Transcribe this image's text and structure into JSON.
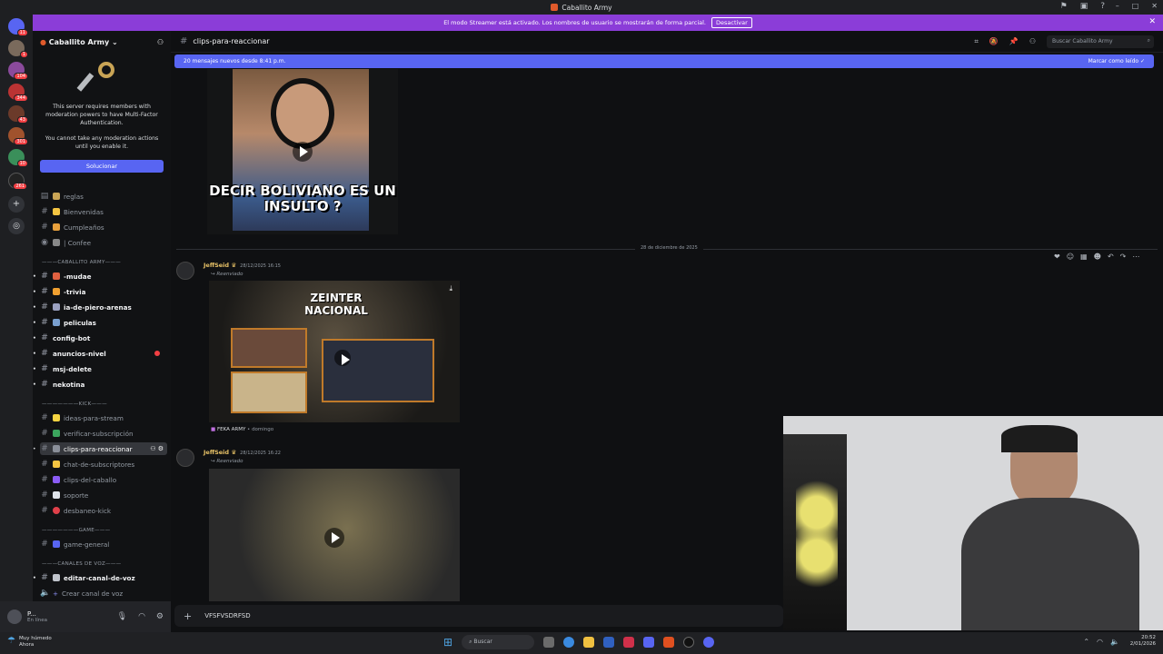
{
  "window": {
    "title": "Caballito Army"
  },
  "streamer_banner": {
    "text": "El modo Streamer está activado. Los nombres de usuario se mostrarán de forma parcial.",
    "button": "Desactivar"
  },
  "servers": [
    {
      "badge": "11"
    },
    {
      "badge": "1"
    },
    {
      "badge": "104"
    },
    {
      "badge": "344"
    },
    {
      "badge": "43"
    },
    {
      "badge": "301"
    },
    {
      "badge": "10"
    },
    {
      "badge": "261"
    }
  ],
  "sidebar": {
    "guild_name": "Caballito Army",
    "mfa_notice": {
      "line1": "This server requires members with moderation powers to have Multi-Factor Authentication.",
      "line2": "You cannot take any moderation actions until you enable it.",
      "fix_button": "Solucionar"
    },
    "channels_top": [
      {
        "name": "reglas"
      },
      {
        "name": "Bienvenidas"
      },
      {
        "name": "Cumpleaños"
      },
      {
        "name": "| Confee"
      }
    ],
    "cat_caballito": "———CABALLITO ARMY———",
    "channels_caballito": [
      {
        "name": "-mudae"
      },
      {
        "name": "-trivia"
      },
      {
        "name": "ia-de-piero-arenas"
      },
      {
        "name": "peliculas"
      },
      {
        "name": "config-bot"
      },
      {
        "name": "anuncios-nivel"
      },
      {
        "name": "msj-delete"
      },
      {
        "name": "nekotina"
      }
    ],
    "cat_kick": "———————KICK———",
    "channels_kick": [
      {
        "name": "ideas-para-stream"
      },
      {
        "name": "verificar-subscripción"
      },
      {
        "name": "clips-para-reaccionar"
      },
      {
        "name": "chat-de-subscriptores"
      },
      {
        "name": "clips-del-caballo"
      },
      {
        "name": "soporte"
      },
      {
        "name": "desbaneo-kick"
      }
    ],
    "cat_game": "———————GAME———",
    "channels_game": [
      {
        "name": "game-general"
      }
    ],
    "cat_voice": "———CANALES DE VOZ———",
    "channels_voice": [
      {
        "name": "editar-canal-de-voz"
      },
      {
        "name": "Crear canal de voz"
      }
    ]
  },
  "user": {
    "name": "P...",
    "status": "En línea"
  },
  "header": {
    "channel": "clips-para-reaccionar",
    "search_placeholder": "Buscar Caballito Army"
  },
  "new_messages_bar": {
    "text": "20 mensajes nuevos desde 8:41 p.m.",
    "action": "Marcar como leído"
  },
  "video1": {
    "caption": "DECIR BOLIVIANO ES UN INSULTO ?"
  },
  "date_divider": "28 de diciembre de 2025",
  "messages": [
    {
      "author": "JeffSeid",
      "timestamp": "28/12/2025 16:15",
      "forwarded": "Reenviado",
      "video_title": "ZEINTER NACIONAL",
      "source": "FEKA ARMY",
      "source_time": "domingo"
    },
    {
      "author": "JeffSeid",
      "timestamp": "28/12/2025 16:22",
      "forwarded": "Reenviado"
    }
  ],
  "composer": {
    "value": "VFSFVSDRFSD"
  },
  "taskbar": {
    "weather_line1": "Muy húmedo",
    "weather_line2": "Ahora",
    "search": "Buscar",
    "time": "20:52",
    "date": "2/01/2026"
  }
}
